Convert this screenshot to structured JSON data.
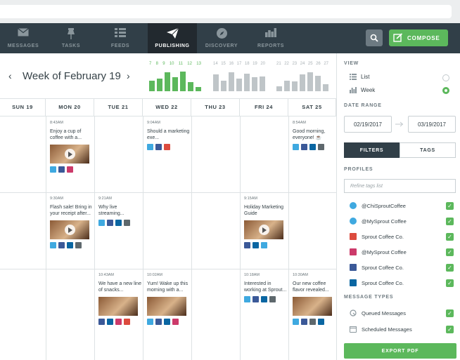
{
  "nav": {
    "items": [
      {
        "label": "MESSAGES",
        "icon": "envelope-icon"
      },
      {
        "label": "TASKS",
        "icon": "pin-icon"
      },
      {
        "label": "FEEDS",
        "icon": "feeds-icon"
      },
      {
        "label": "PUBLISHING",
        "icon": "paper-plane-icon",
        "active": true
      },
      {
        "label": "DISCOVERY",
        "icon": "compass-icon"
      },
      {
        "label": "REPORTS",
        "icon": "bar-chart-icon"
      }
    ],
    "compose_label": "COMPOSE"
  },
  "calendar": {
    "week_title": "Week of February 19",
    "prev_arrow": "‹",
    "next_arrow": "›",
    "sparks": [
      {
        "nums": [
          "7",
          "8",
          "9",
          "10",
          "11",
          "12",
          "13"
        ],
        "heights": [
          0.55,
          0.65,
          0.95,
          0.7,
          1.0,
          0.45,
          0.2
        ],
        "color": "#5cb85c",
        "numcolor": "#5cb85c"
      },
      {
        "nums": [
          "14",
          "15",
          "16",
          "17",
          "18",
          "19",
          "20"
        ],
        "heights": [
          0.85,
          0.55,
          0.95,
          0.65,
          0.9,
          0.7,
          0.75
        ],
        "color": "#bfc5c8",
        "numcolor": "#aab2b6"
      },
      {
        "nums": [
          "21",
          "22",
          "23",
          "24",
          "25",
          "26",
          "27"
        ],
        "heights": [
          0.25,
          0.55,
          0.5,
          0.85,
          0.95,
          0.8,
          0.35
        ],
        "color": "#bfc5c8",
        "numcolor": "#aab2b6"
      }
    ],
    "days": [
      "SUN 19",
      "MON 20",
      "TUE 21",
      "WED 22",
      "THU 23",
      "FRI 24",
      "SAT 25"
    ],
    "posts": [
      {
        "day": 1,
        "row": 0,
        "time": "8:43AM",
        "text": "Enjoy a cup of coffee with a...",
        "image": true,
        "play": true,
        "icons": [
          "tw",
          "fb",
          "ig"
        ]
      },
      {
        "day": 3,
        "row": 0,
        "time": "9:04AM",
        "text": "Should a marketing exe...",
        "image": false,
        "icons": [
          "tw",
          "fb",
          "gp"
        ]
      },
      {
        "day": 6,
        "row": 0,
        "time": "8:54AM",
        "text": "Good morning, everyone! ☕",
        "image": false,
        "icons": [
          "tw",
          "fb",
          "li",
          "ot"
        ]
      },
      {
        "day": 1,
        "row": 1,
        "time": "9:30AM",
        "text": "Flash sale! Bring in your receipt after...",
        "image": true,
        "play": true,
        "icons": [
          "tw",
          "fb",
          "li",
          "ot"
        ]
      },
      {
        "day": 2,
        "row": 1,
        "time": "9:21AM",
        "text": "Why live streaming...",
        "image": false,
        "icons": [
          "tw",
          "fb",
          "li",
          "ot"
        ]
      },
      {
        "day": 5,
        "row": 1,
        "time": "9:15AM",
        "text": "Holiday Marketing Guide",
        "image": true,
        "play": true,
        "icons": [
          "fb",
          "li",
          "tw"
        ]
      },
      {
        "day": 2,
        "row": 2,
        "time": "10:43AM",
        "text": "We have a new line of snacks...",
        "image": true,
        "play": false,
        "icons": [
          "fb",
          "li",
          "ig",
          "gp"
        ]
      },
      {
        "day": 3,
        "row": 2,
        "time": "10:02AM",
        "text": "Yum! Wake up this morning with a...",
        "image": true,
        "play": false,
        "icons": [
          "tw",
          "fb",
          "li",
          "ig"
        ]
      },
      {
        "day": 5,
        "row": 2,
        "time": "10:18AM",
        "text": "Interested in working at Sprout...",
        "image": false,
        "icons": [
          "tw",
          "fb",
          "li",
          "ot"
        ]
      },
      {
        "day": 6,
        "row": 2,
        "time": "10:30AM",
        "text": "Our new coffee flavor revealed...",
        "image": true,
        "play": false,
        "icons": [
          "tw",
          "fb",
          "ot",
          "li"
        ]
      }
    ]
  },
  "sidebar": {
    "view_label": "VIEW",
    "view_options": [
      {
        "label": "List",
        "icon": "list-icon",
        "selected": false
      },
      {
        "label": "Week",
        "icon": "week-bars-icon",
        "selected": true
      }
    ],
    "date_range_label": "DATE RANGE",
    "date_start": "02/19/2017",
    "date_end": "03/19/2017",
    "tabs": [
      {
        "label": "FILTERS",
        "active": true
      },
      {
        "label": "TAGS",
        "active": false
      }
    ],
    "profiles_label": "PROFILES",
    "refine_placeholder": "Refine tags list",
    "profiles": [
      {
        "label": "@ChiSproutCoffee",
        "net": "tw"
      },
      {
        "label": "@MySprout Coffee",
        "net": "tw"
      },
      {
        "label": "Sprout Coffee Co.",
        "net": "gp"
      },
      {
        "label": "@MySprout Coffee",
        "net": "ig"
      },
      {
        "label": "Sprout Coffee Co.",
        "net": "fb"
      },
      {
        "label": "Sprout Coffee Co.",
        "net": "li"
      }
    ],
    "message_types_label": "MESSAGE TYPES",
    "message_types": [
      {
        "label": "Queued Messages",
        "icon": "queue-icon"
      },
      {
        "label": "Scheduled Messages",
        "icon": "calendar-icon"
      }
    ],
    "check_glyph": "✓",
    "export_label": "EXPORT PDF"
  }
}
